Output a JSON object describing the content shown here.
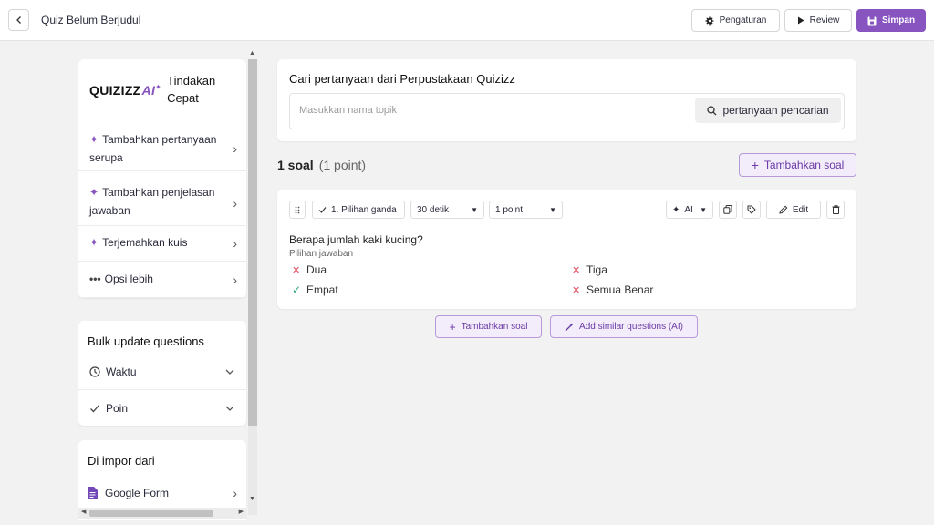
{
  "header": {
    "title": "Quiz Belum Berjudul",
    "settings_label": "Pengaturan",
    "review_label": "Review",
    "save_label": "Simpan",
    "accent_color": "#8854c0"
  },
  "sidebar": {
    "quick_actions": {
      "logo_text": "QUIZIZZ",
      "logo_ai": "AI",
      "title": "Tindakan Cepat",
      "items": [
        {
          "label": "Tambahkan pertanyaan serupa",
          "icon": "sparkle-icon"
        },
        {
          "label": "Tambahkan penjelasan jawaban",
          "icon": "sparkle-icon"
        },
        {
          "label": "Terjemahkan kuis",
          "icon": "sparkle-icon"
        },
        {
          "label": "Opsi lebih",
          "icon": "ellipsis-icon"
        }
      ]
    },
    "bulk_update": {
      "title": "Bulk update questions",
      "items": [
        {
          "label": "Waktu",
          "icon": "clock-icon"
        },
        {
          "label": "Poin",
          "icon": "check-icon"
        }
      ]
    },
    "import": {
      "title": "Di impor dari",
      "items": [
        {
          "label": "Google Form",
          "icon": "google-form-icon"
        }
      ]
    }
  },
  "search": {
    "title": "Cari pertanyaan dari Perpustakaan Quizizz",
    "placeholder": "Masukkan nama topik",
    "button_label": "pertanyaan pencarian"
  },
  "summary": {
    "count": "1 soal",
    "points": "(1 point)",
    "add_label": "Tambahkan soal"
  },
  "question": {
    "type_label": "1. Pilihan ganda",
    "time_value": "30 detik",
    "point_value": "1 point",
    "ai_label": "AI",
    "edit_label": "Edit",
    "text": "Berapa jumlah kaki kucing?",
    "answers_label": "Pilihan jawaban",
    "answers": [
      {
        "text": "Dua",
        "correct": false
      },
      {
        "text": "Tiga",
        "correct": false
      },
      {
        "text": "Empat",
        "correct": true
      },
      {
        "text": "Semua Benar",
        "correct": false
      }
    ]
  },
  "bottom_actions": {
    "add_label": "Tambahkan soal",
    "similar_label": "Add similar questions (AI)"
  }
}
